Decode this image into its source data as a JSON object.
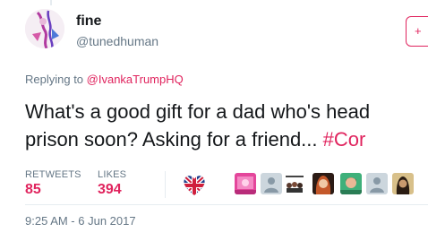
{
  "tweet": {
    "display_name": "fine",
    "handle": "@tunedhuman",
    "replying_prefix": "Replying to ",
    "replying_mention": "@IvankaTrumpHQ",
    "text_line1": "What's a good gift for a dad who's head",
    "text_line2_main": "prison soon? Asking for a friend... ",
    "text_line2_hashtag": "#Cor",
    "timestamp": "9:25 AM - 6 Jun 2017",
    "follow_glyph": "+"
  },
  "stats": {
    "retweets_label": "RETWEETS",
    "retweets_value": "85",
    "likes_label": "LIKES",
    "likes_value": "394"
  },
  "colors": {
    "accent": "#e0245e",
    "secondary_text": "#657786",
    "primary_text": "#14171a"
  },
  "likers": [
    {
      "icon": "heart-flag-avatar"
    },
    {
      "icon": "pink-avatar"
    },
    {
      "icon": "default-egg-avatar"
    },
    {
      "icon": "movie-poster-avatar"
    },
    {
      "icon": "redhead-avatar"
    },
    {
      "icon": "green-avatar"
    },
    {
      "icon": "default-egg-avatar"
    },
    {
      "icon": "portrait-avatar"
    }
  ]
}
